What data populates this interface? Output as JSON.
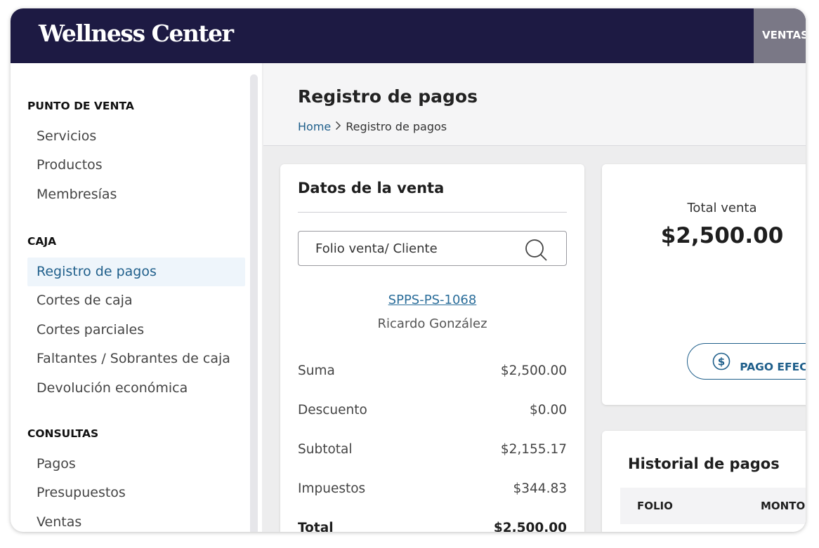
{
  "header": {
    "brand": "Wellness Center",
    "nav_label": "VENTAS"
  },
  "sidebar": {
    "sections": [
      {
        "title": "PUNTO DE VENTA",
        "items": [
          "Servicios",
          "Productos",
          "Membresías"
        ]
      },
      {
        "title": "CAJA",
        "items": [
          "Registro de pagos",
          "Cortes de caja",
          "Cortes parciales",
          "Faltantes / Sobrantes de caja",
          "Devolución económica"
        ]
      },
      {
        "title": "CONSULTAS",
        "items": [
          "Pagos",
          "Presupuestos",
          "Ventas"
        ]
      }
    ],
    "active_item": "Registro de pagos"
  },
  "page": {
    "title": "Registro de pagos",
    "breadcrumb": {
      "home": "Home",
      "current": "Registro de pagos"
    }
  },
  "sale": {
    "title": "Datos de la venta",
    "search_placeholder": "Folio venta/ Cliente",
    "folio": "SPPS-PS-1068",
    "client": "Ricardo González",
    "rows": [
      {
        "label": "Suma",
        "value": "$2,500.00"
      },
      {
        "label": "Descuento",
        "value": "$0.00"
      },
      {
        "label": "Subtotal",
        "value": "$2,155.17"
      },
      {
        "label": "Impuestos",
        "value": "$344.83"
      },
      {
        "label": "Total",
        "value": "$2,500.00"
      }
    ]
  },
  "total": {
    "label": "Total venta",
    "amount": "$2,500.00",
    "pay_button": "PAGO EFECTIVO"
  },
  "history": {
    "title": "Historial de pagos",
    "columns": [
      "FOLIO",
      "MONTO"
    ]
  },
  "colors": {
    "header_bg": "#1d1a43",
    "accent": "#1f5f8b",
    "active_bg": "#eef5fb"
  }
}
